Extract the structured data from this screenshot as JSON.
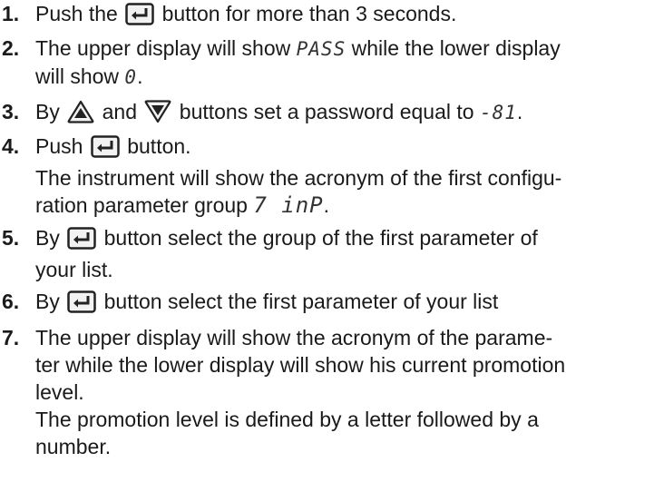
{
  "steps": [
    {
      "num": "1.",
      "lines": [
        {
          "a": "Push the ",
          "b": " button for more than 3 seconds."
        }
      ]
    },
    {
      "num": "2.",
      "lines": [
        {
          "a": "The upper display will show ",
          "seg": "PASS",
          "b": " while the lower display"
        },
        {
          "text": "will show "
        }
      ],
      "seg2": "0",
      "tail2": "."
    },
    {
      "num": "3.",
      "lines": [
        {
          "a": "By ",
          "b": " and ",
          "c": " buttons set a password equal to ",
          "seg": "-81",
          "d": "."
        }
      ]
    },
    {
      "num": "4.",
      "lines": [
        {
          "a": "Push ",
          "b": " button."
        },
        {
          "text": "The instrument will show the acronym of the first configu-"
        },
        {
          "text": "ration parameter group "
        }
      ],
      "seg3": "7 inP",
      "tail3": "."
    },
    {
      "num": "5.",
      "lines": [
        {
          "a": "By ",
          "b": " button select the group of the first parameter of"
        },
        {
          "text": "your list."
        }
      ]
    },
    {
      "num": "6.",
      "lines": [
        {
          "a": "By ",
          "b": " button select the first parameter of your list"
        }
      ]
    },
    {
      "num": "7.",
      "lines": [
        {
          "text": "The upper display will show the acronym of the parame-"
        },
        {
          "text": "ter  while the lower display will show his current promotion"
        },
        {
          "text": "level."
        },
        {
          "text": "The promotion level is defined by a letter followed by a"
        },
        {
          "text": "number."
        }
      ]
    }
  ],
  "icons": {
    "enter": "enter-button-icon",
    "up": "up-arrow-button-icon",
    "down": "down-arrow-button-icon"
  }
}
